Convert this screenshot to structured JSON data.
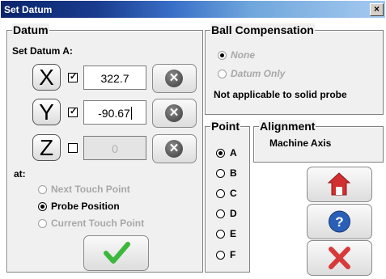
{
  "window": {
    "title": "Set Datum",
    "close_glyph": "×"
  },
  "datum": {
    "legend": "Datum",
    "set_label": "Set Datum A:",
    "axes": [
      {
        "name": "X",
        "checked": true,
        "value": "322.7",
        "enabled": true
      },
      {
        "name": "Y",
        "checked": true,
        "value": "-90.67",
        "enabled": true
      },
      {
        "name": "Z",
        "checked": false,
        "value": "0",
        "enabled": false
      }
    ],
    "at_label": "at:",
    "at_options": [
      {
        "label": "Next Touch Point",
        "selected": false,
        "enabled": false
      },
      {
        "label": "Probe Position",
        "selected": true,
        "enabled": true
      },
      {
        "label": "Current Touch Point",
        "selected": false,
        "enabled": false
      }
    ]
  },
  "ball_compensation": {
    "legend": "Ball Compensation",
    "options": [
      {
        "label": "None",
        "selected": true,
        "enabled": false
      },
      {
        "label": "Datum Only",
        "selected": false,
        "enabled": false
      }
    ],
    "note": "Not applicable to solid probe"
  },
  "point": {
    "legend": "Point",
    "options": [
      {
        "label": "A",
        "selected": true
      },
      {
        "label": "B",
        "selected": false
      },
      {
        "label": "C",
        "selected": false
      },
      {
        "label": "D",
        "selected": false
      },
      {
        "label": "E",
        "selected": false
      },
      {
        "label": "F",
        "selected": false
      }
    ]
  },
  "alignment": {
    "legend": "Alignment",
    "value": "Machine Axis"
  },
  "icons": {
    "clear": "clear-x-icon",
    "ok": "check-icon",
    "home": "home-icon",
    "help": "help-icon",
    "cancel": "cancel-x-icon"
  },
  "colors": {
    "ok_green": "#3cb83c",
    "home_red": "#d03030",
    "help_blue": "#2a5fb8",
    "cancel_red": "#d83a3a",
    "title_dark": "#0a246a",
    "title_light": "#a6caf0"
  }
}
